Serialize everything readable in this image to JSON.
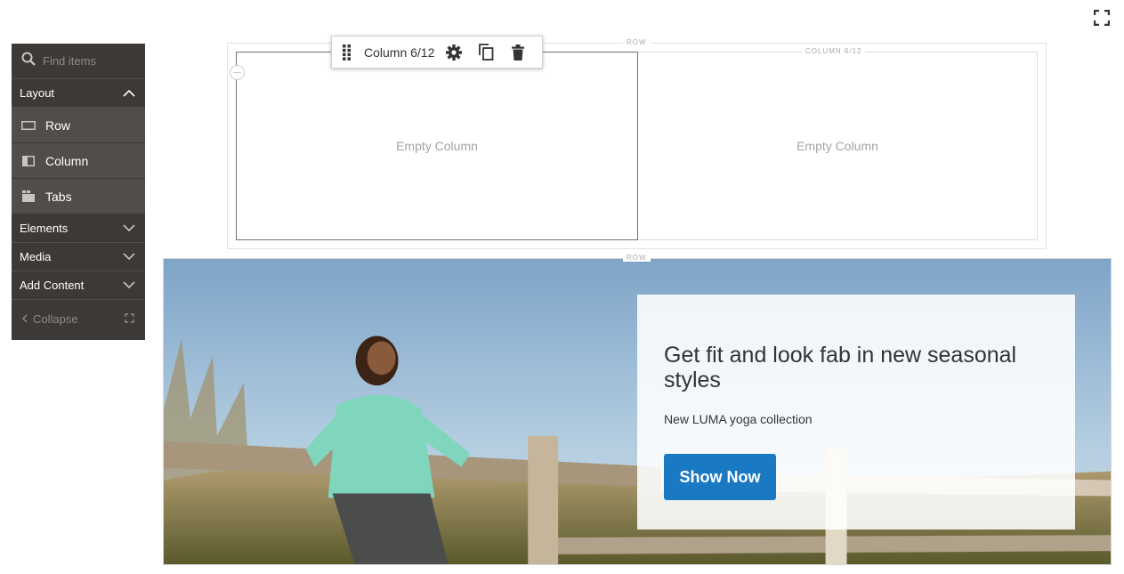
{
  "sidebar": {
    "search_placeholder": "Find items",
    "layout_section": "Layout",
    "layout_items": [
      {
        "label": "Row",
        "icon": "row-icon"
      },
      {
        "label": "Column",
        "icon": "column-icon"
      },
      {
        "label": "Tabs",
        "icon": "tabs-icon"
      }
    ],
    "sections": [
      {
        "label": "Elements"
      },
      {
        "label": "Media"
      },
      {
        "label": "Add Content"
      }
    ],
    "collapse_label": "Collapse"
  },
  "stage": {
    "row_label": "ROW",
    "column_label": "COLUMN 6/12",
    "empty_column_text": "Empty Column",
    "toolbar": {
      "title": "Column 6/12",
      "icons": [
        "drag-handle-icon",
        "gear-icon",
        "copy-icon",
        "trash-icon"
      ]
    }
  },
  "banner": {
    "row_label": "ROW",
    "title": "Get fit and look fab in new seasonal styles",
    "subtitle": "New LUMA yoga collection",
    "button_label": "Show Now"
  },
  "colors": {
    "sidebar_bg": "#3d3936",
    "sidebar_item_bg": "#524d49",
    "button_blue": "#1979c3"
  }
}
